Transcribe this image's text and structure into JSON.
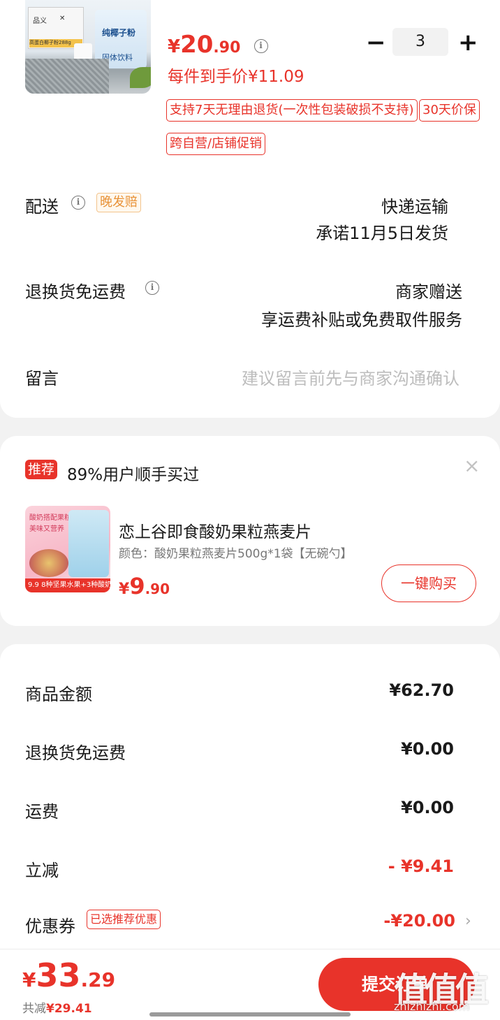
{
  "product": {
    "image_texts": {
      "pack_title": "纯椰子粉",
      "pack_sub": "固体饮料",
      "tag": "高蛋白椰子粉288g"
    },
    "price_symbol": "¥",
    "price_int": "20",
    "price_dec": ".90",
    "unit_price_text": "每件到手价¥11.09",
    "quantity": "3",
    "minus_label": "−",
    "plus_label": "+",
    "badges": [
      "支持7天无理由退货(一次性包装破损不支持)",
      "30天价保",
      "跨自营/店铺促销"
    ]
  },
  "delivery": {
    "label": "配送",
    "badge": "晚发赔",
    "method": "快递运输",
    "promise": "承诺11月5日发货"
  },
  "return_shipping": {
    "label": "退换货免运费",
    "value1": "商家赠送",
    "value2": "享运费补贴或免费取件服务"
  },
  "message": {
    "label": "留言",
    "placeholder": "建议留言前先与商家沟通确认"
  },
  "recommend": {
    "tag": "推荐",
    "title": "89%用户顺手买过",
    "close": "×",
    "item_name": "恋上谷即食酸奶果粒燕麦片",
    "item_spec": "颜色：酸奶果粒燕麦片500g*1袋【无碗勺】",
    "price_symbol": "¥",
    "price_int": "9",
    "price_dec": ".90",
    "buy_label": "一键购买",
    "image_texts": {
      "top": "酸奶搭配果粒",
      "top2": "美味又营养",
      "foot": "9.9  8种坚果水果+3种酸奶片"
    }
  },
  "summary": {
    "rows": [
      {
        "label": "商品金额",
        "value": "¥62.70"
      },
      {
        "label": "退换货免运费",
        "value": "¥0.00"
      },
      {
        "label": "运费",
        "value": "¥0.00"
      },
      {
        "label": "立减",
        "value": "- ¥9.41"
      },
      {
        "label": "优惠券",
        "badge": "已选推荐优惠",
        "value": "-¥20.00"
      }
    ]
  },
  "bottom": {
    "price_symbol": "¥",
    "price_int": "33",
    "price_dec": ".29",
    "saved_label": "共减",
    "saved_value": "¥29.41",
    "submit_label": "提交订单"
  },
  "watermark": {
    "big": "值值值",
    "small": "zhizhizhi.com"
  },
  "colors": {
    "accent": "#e8332a",
    "badge_orange": "#e89238"
  }
}
